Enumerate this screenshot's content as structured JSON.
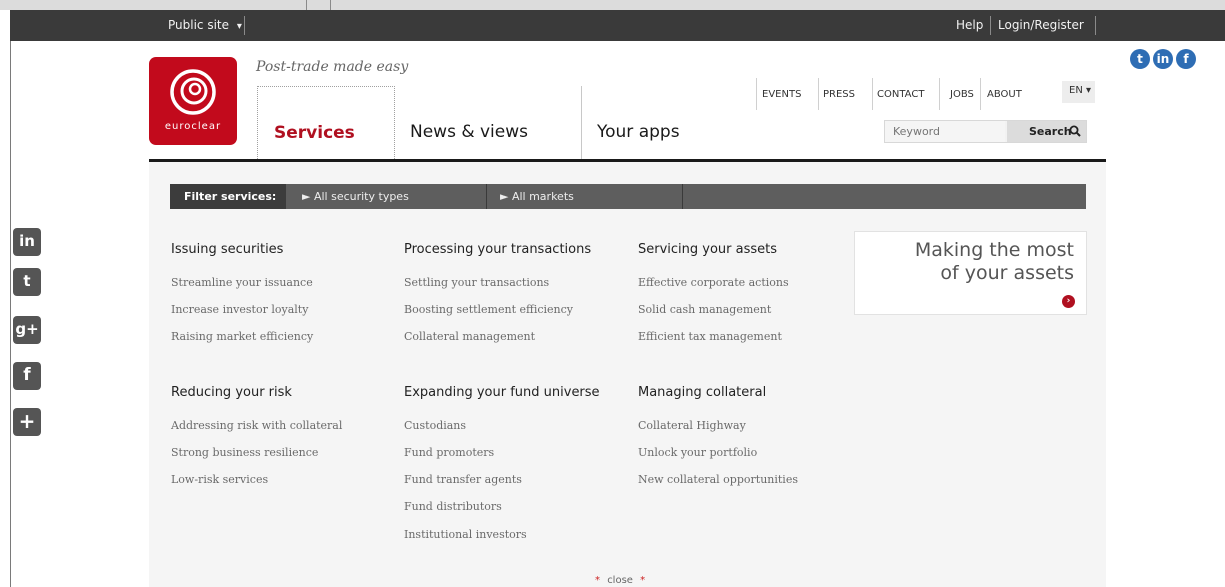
{
  "topbar": {
    "public_site": "Public site",
    "public_site_caret": "▾",
    "help": "Help",
    "login": "Login/Register"
  },
  "social_top": [
    {
      "icon": "twitter-icon",
      "glyph": "t"
    },
    {
      "icon": "linkedin-icon",
      "glyph": "in"
    },
    {
      "icon": "facebook-icon",
      "glyph": "f"
    }
  ],
  "brand": {
    "logo_text": "euroclear",
    "tagline": "Post-trade made easy",
    "brand_red": "#c20a1c"
  },
  "nav": {
    "services": "Services",
    "news": "News & views",
    "apps": "Your apps"
  },
  "utility": {
    "events": "EVENTS",
    "press": "PRESS",
    "contact": "CONTACT",
    "jobs": "JOBS",
    "about": "ABOUT",
    "lang": "EN ▾"
  },
  "search": {
    "placeholder": "Keyword",
    "button": "Search"
  },
  "filter": {
    "label": "Filter services:",
    "security": "► All security types",
    "markets": "► All markets"
  },
  "columns": {
    "issuing": {
      "heading": "Issuing securities",
      "links": [
        "Streamline your issuance",
        "Increase investor loyalty",
        "Raising market efficiency"
      ]
    },
    "processing": {
      "heading": "Processing your transactions",
      "links": [
        "Settling your transactions",
        "Boosting settlement efficiency",
        "Collateral management"
      ]
    },
    "servicing": {
      "heading": "Servicing your assets",
      "links": [
        "Effective corporate actions",
        "Solid cash management",
        "Efficient tax management"
      ]
    },
    "risk": {
      "heading": "Reducing your risk",
      "links": [
        "Addressing risk with collateral",
        "Strong business resilience",
        "Low-risk services"
      ]
    },
    "funds": {
      "heading": "Expanding your fund universe",
      "links": [
        "Custodians",
        "Fund promoters",
        "Fund transfer agents",
        "Fund distributors",
        "Institutional investors"
      ]
    },
    "collateral": {
      "heading": "Managing collateral",
      "links": [
        "Collateral Highway",
        "Unlock your portfolio",
        "New collateral opportunities"
      ]
    }
  },
  "promo": {
    "line1": "Making the most",
    "line2": "of your assets",
    "arrow": "›"
  },
  "share": [
    {
      "icon": "linkedin-share-icon",
      "glyph": "in"
    },
    {
      "icon": "twitter-share-icon",
      "glyph": "t"
    },
    {
      "icon": "googleplus-share-icon",
      "glyph": "g+"
    },
    {
      "icon": "facebook-share-icon",
      "glyph": "f"
    },
    {
      "icon": "more-share-icon",
      "glyph": "+"
    }
  ],
  "close": {
    "star": "*",
    "label": "close"
  }
}
